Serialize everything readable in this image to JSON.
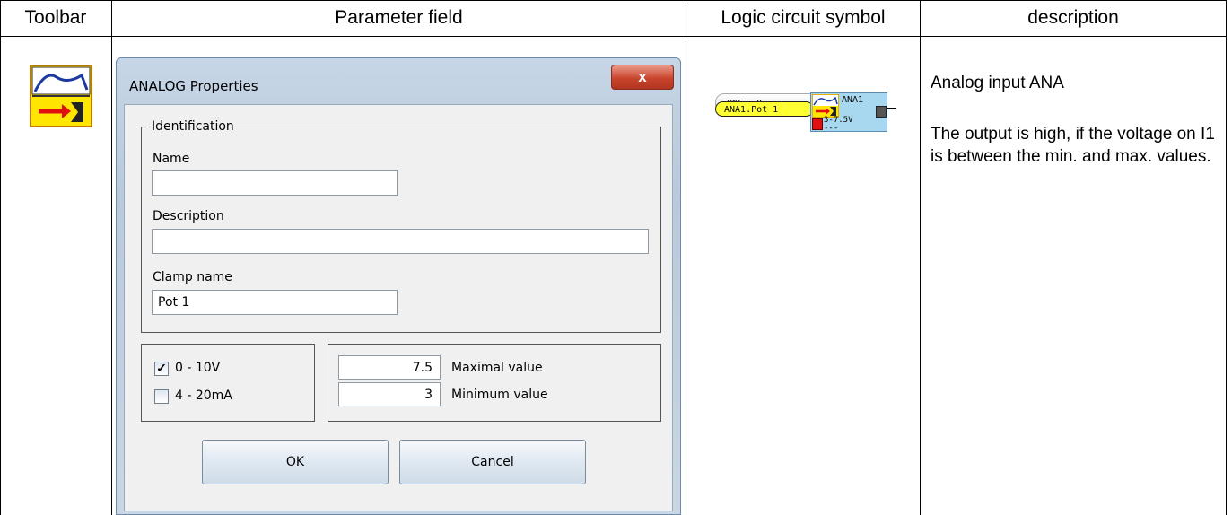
{
  "table": {
    "headers": {
      "toolbar": "Toolbar",
      "parameter_field": "Parameter field",
      "logic_symbol": "Logic circuit symbol",
      "description": "description"
    }
  },
  "dialog": {
    "title": "ANALOG Properties",
    "close_glyph": "x",
    "identification": {
      "legend": "Identification",
      "name_label": "Name",
      "name_value": "",
      "description_label": "Description",
      "description_value": "",
      "clamp_label": "Clamp name",
      "clamp_value": "Pot 1"
    },
    "ranges": [
      {
        "label": "0 - 10V",
        "checked": true
      },
      {
        "label": "4 - 20mA",
        "checked": false
      }
    ],
    "values": {
      "max_value": "7.5",
      "max_label": "Maximal value",
      "min_value": "3",
      "min_label": "Minimum value"
    },
    "buttons": {
      "ok": "OK",
      "cancel": "Cancel"
    }
  },
  "logic": {
    "zmv_label": "ZMV",
    "zmv_value": "0",
    "input_label": "ANA1.Pot 1",
    "block_name": "ANA1",
    "block_range": "3-7.5V",
    "block_dashes": "---"
  },
  "description": {
    "title": "Analog input ANA",
    "text": "The output is high, if the voltage on I1 is between the min. and max. values."
  },
  "colors": {
    "toolbar_icon_bg": "#ffe600",
    "input_highlight": "#ffff33",
    "block_bg": "#a8d8f0",
    "close_red": "#c9452d"
  }
}
